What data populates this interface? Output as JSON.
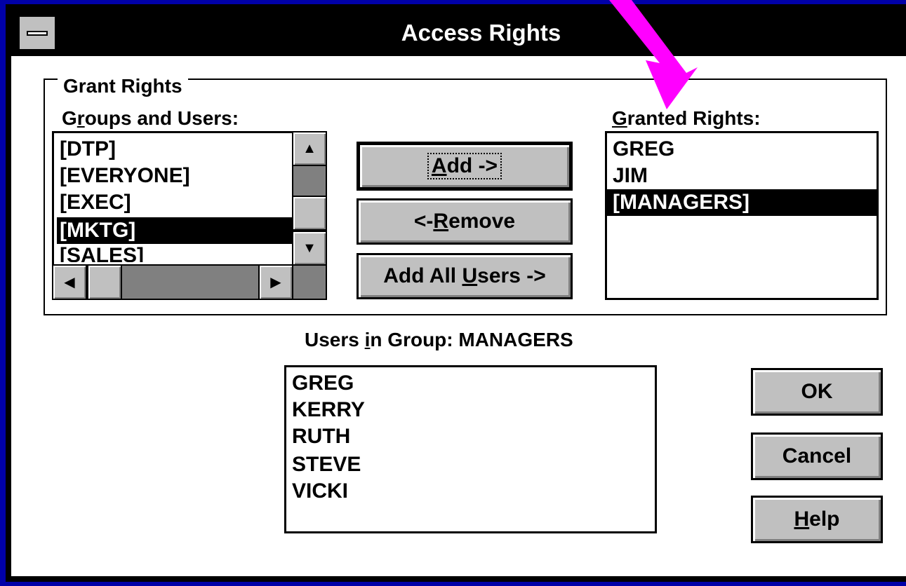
{
  "window": {
    "title": "Access Rights"
  },
  "grant_rights": {
    "group_label": "Grant Rights",
    "groups_and_users_label_prefix": "G",
    "groups_and_users_label_accel": "r",
    "groups_and_users_label_rest": "oups and Users:",
    "groups_and_users": [
      "[DTP]",
      "[EVERYONE]",
      "[EXEC]",
      "[MKTG]",
      "[SALES]"
    ],
    "selected_index": 3,
    "granted_rights_label_accel": "G",
    "granted_rights_label_rest": "ranted Rights:",
    "granted_rights": [
      "GREG",
      "JIM",
      "[MANAGERS]"
    ],
    "granted_selected_index": 2
  },
  "buttons": {
    "add_accel": "A",
    "add_rest": "dd ->",
    "remove_prefix": "<- ",
    "remove_accel": "R",
    "remove_rest": "emove",
    "add_all_prefix": "Add All ",
    "add_all_accel": "U",
    "add_all_rest": "sers ->",
    "ok": "OK",
    "cancel": "Cancel",
    "help_accel": "H",
    "help_rest": "elp"
  },
  "users_in_group": {
    "label_prefix": "Users ",
    "label_accel": "i",
    "label_rest": "n Group: MANAGERS",
    "members": [
      "GREG",
      "KERRY",
      "RUTH",
      "STEVE",
      "VICKI"
    ]
  },
  "annotation": {
    "arrow_color": "#ff00ff"
  }
}
